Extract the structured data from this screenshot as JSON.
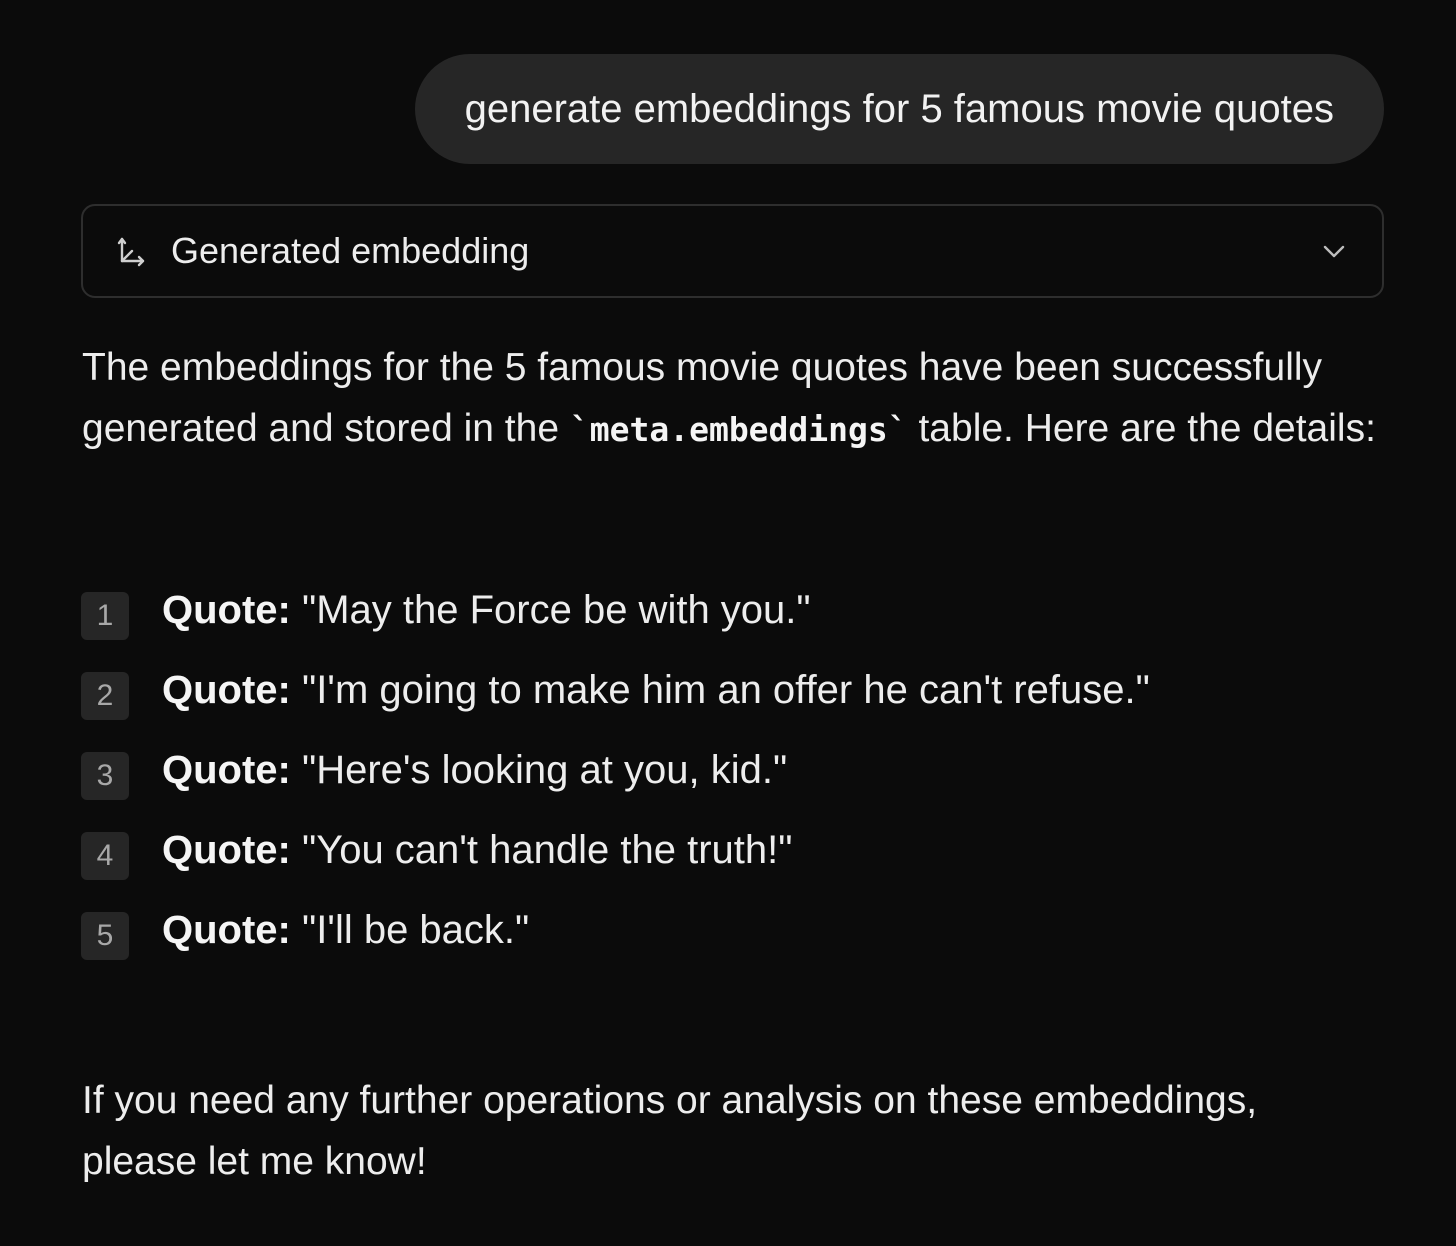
{
  "user_message": "generate embeddings for 5 famous movie quotes",
  "tool_call": {
    "label": "Generated embedding",
    "icon": "axis-icon",
    "expand_icon": "chevron-down-icon"
  },
  "response": {
    "intro_part1": "The embeddings for the 5 famous movie quotes have been successfully generated and stored in the ",
    "intro_code": "`meta.embeddings`",
    "intro_part2": " table. Here are the details:",
    "items": [
      {
        "number": "1",
        "label": "Quote:",
        "text": " \"May the Force be with you.\""
      },
      {
        "number": "2",
        "label": "Quote:",
        "text": " \"I'm going to make him an offer he can't refuse.\""
      },
      {
        "number": "3",
        "label": "Quote:",
        "text": " \"Here's looking at you, kid.\""
      },
      {
        "number": "4",
        "label": "Quote:",
        "text": " \"You can't handle the truth!\""
      },
      {
        "number": "5",
        "label": "Quote:",
        "text": " \"I'll be back.\""
      }
    ],
    "outro": "If you need any further operations or analysis on these embeddings, please let me know!"
  }
}
